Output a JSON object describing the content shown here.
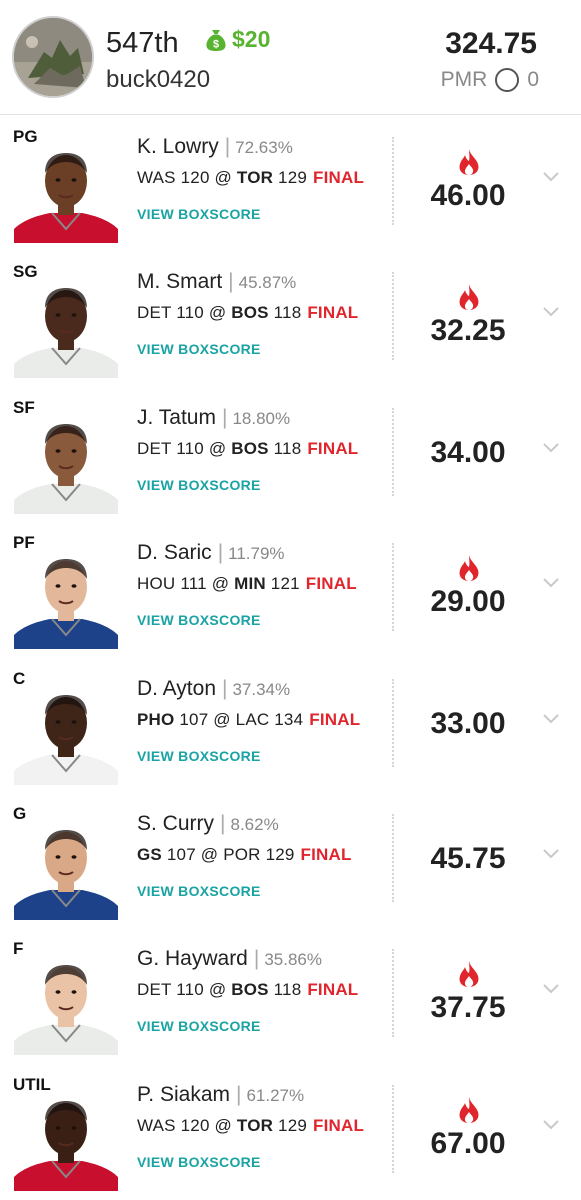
{
  "header": {
    "rank": "547th",
    "prize": "$20",
    "username": "buck0420",
    "total_points": "324.75",
    "pmr_label": "PMR",
    "pmr_value": "0"
  },
  "boxscore_label": "VIEW BOXSCORE",
  "colors": {
    "final": "#e0262c",
    "link": "#1aa3a3",
    "prize": "#58b330",
    "fire": "#e0262c"
  },
  "players": [
    {
      "position": "PG",
      "name": "K. Lowry",
      "own_pct": "72.63%",
      "away": "WAS",
      "away_score": "120",
      "home": "TOR",
      "home_score": "129",
      "bold": "home",
      "status": "FINAL",
      "points": "46.00",
      "hot": true,
      "jersey": "#c8102e",
      "skin": "#6b3e26"
    },
    {
      "position": "SG",
      "name": "M. Smart",
      "own_pct": "45.87%",
      "away": "DET",
      "away_score": "110",
      "home": "BOS",
      "home_score": "118",
      "bold": "home",
      "status": "FINAL",
      "points": "32.25",
      "hot": true,
      "jersey": "#e9ece9",
      "skin": "#4a2a1c"
    },
    {
      "position": "SF",
      "name": "J. Tatum",
      "own_pct": "18.80%",
      "away": "DET",
      "away_score": "110",
      "home": "BOS",
      "home_score": "118",
      "bold": "home",
      "status": "FINAL",
      "points": "34.00",
      "hot": false,
      "jersey": "#e9ece9",
      "skin": "#8a5a3c"
    },
    {
      "position": "PF",
      "name": "D. Saric",
      "own_pct": "11.79%",
      "away": "HOU",
      "away_score": "111",
      "home": "MIN",
      "home_score": "121",
      "bold": "home",
      "status": "FINAL",
      "points": "29.00",
      "hot": true,
      "jersey": "#1d428a",
      "skin": "#e3b89a"
    },
    {
      "position": "C",
      "name": "D. Ayton",
      "own_pct": "37.34%",
      "away": "PHO",
      "away_score": "107",
      "home": "LAC",
      "home_score": "134",
      "bold": "away",
      "status": "FINAL",
      "points": "33.00",
      "hot": false,
      "jersey": "#f2f2f2",
      "skin": "#3f2418"
    },
    {
      "position": "G",
      "name": "S. Curry",
      "own_pct": "8.62%",
      "away": "GS",
      "away_score": "107",
      "home": "POR",
      "home_score": "129",
      "bold": "away",
      "status": "FINAL",
      "points": "45.75",
      "hot": false,
      "jersey": "#1d428a",
      "skin": "#d9a887"
    },
    {
      "position": "F",
      "name": "G. Hayward",
      "own_pct": "35.86%",
      "away": "DET",
      "away_score": "110",
      "home": "BOS",
      "home_score": "118",
      "bold": "home",
      "status": "FINAL",
      "points": "37.75",
      "hot": true,
      "jersey": "#e9ece9",
      "skin": "#eac3a6"
    },
    {
      "position": "UTIL",
      "name": "P. Siakam",
      "own_pct": "61.27%",
      "away": "WAS",
      "away_score": "120",
      "home": "TOR",
      "home_score": "129",
      "bold": "home",
      "status": "FINAL",
      "points": "67.00",
      "hot": true,
      "jersey": "#c8102e",
      "skin": "#3a1f14"
    }
  ]
}
